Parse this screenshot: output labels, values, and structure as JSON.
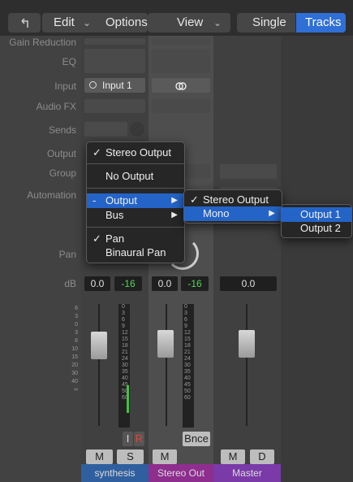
{
  "toolbar": {
    "back_icon": "back-arrow-icon",
    "edit": "Edit",
    "options": "Options",
    "view": "View",
    "single": "Single",
    "tracks": "Tracks",
    "chevron": "⌄"
  },
  "rows": {
    "gain_reduction": "Gain Reduction",
    "eq": "EQ",
    "input": "Input",
    "audio_fx": "Audio FX",
    "sends": "Sends",
    "output": "Output",
    "group": "Group",
    "automation": "Automation",
    "pan": "Pan",
    "db": "dB"
  },
  "strips": [
    {
      "input": "Input 1",
      "volume": "0.0",
      "peak": "-16",
      "btn_mute": "M",
      "btn_solo": "S",
      "btn_i": "I",
      "btn_r": "R",
      "name": "synthesis",
      "color": "#2f5f9e"
    },
    {
      "input_icon": "stereo-link-icon",
      "volume": "0.0",
      "peak": "-16",
      "btn_mute": "M",
      "bounce": "Bnce",
      "name": "Stereo Out",
      "color": "#8e2e8e"
    },
    {
      "volume": "0.0",
      "btn_mute": "M",
      "btn_d": "D",
      "name": "Master",
      "color": "#7a3aa8"
    }
  ],
  "scale": {
    "left": [
      "6",
      "3",
      "0",
      "3",
      "6",
      "10",
      "15",
      "20",
      "30",
      "40",
      "∞"
    ],
    "meter": [
      "0",
      "3",
      "6",
      "9",
      "12",
      "15",
      "18",
      "21",
      "24",
      "30",
      "35",
      "40",
      "45",
      "50",
      "60"
    ]
  },
  "menu1": {
    "items": [
      {
        "check": "✓",
        "label": "Stereo Output"
      },
      {
        "check": "",
        "label": "No Output"
      },
      {
        "check": "-",
        "label": "Output",
        "arrow": "▶"
      },
      {
        "check": "",
        "label": "Bus",
        "arrow": "▶"
      },
      {
        "check": "✓",
        "label": "Pan"
      },
      {
        "check": "",
        "label": "Binaural Pan"
      }
    ]
  },
  "menu2": {
    "items": [
      {
        "check": "✓",
        "label": "Stereo Output"
      },
      {
        "check": "",
        "label": "Mono",
        "arrow": "▶"
      }
    ]
  },
  "menu3": {
    "items": [
      {
        "label": "Output 1"
      },
      {
        "label": "Output 2"
      }
    ]
  },
  "colors": {
    "accent": "#2f6fd6",
    "menu_highlight": "#2464c7",
    "peak_green": "#57d657",
    "rec_red": "#e0443a"
  }
}
